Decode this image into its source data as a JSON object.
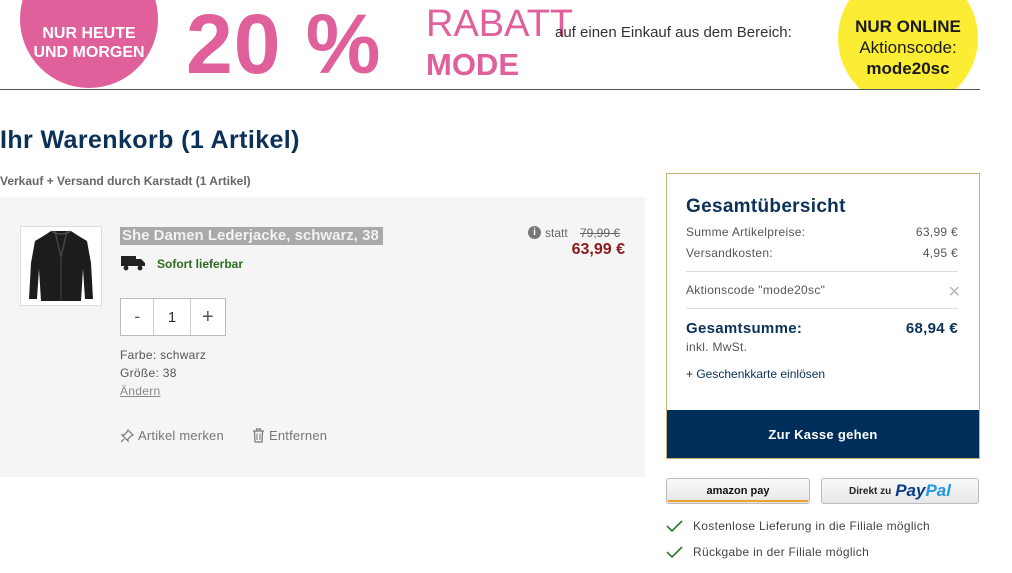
{
  "banner": {
    "left_circle_line1": "NUR HEUTE",
    "left_circle_line2": "UND MORGEN",
    "percent": "20 %",
    "rabatt": "RABATT",
    "mode": "MODE",
    "description": "auf einen Einkauf aus dem Bereich:",
    "online_line1": "NUR ONLINE",
    "online_line2": "Aktionscode:",
    "online_code": "mode20sc"
  },
  "cart": {
    "title": "Ihr Warenkorb (1 Artikel)",
    "seller": "Verkauf + Versand durch Karstadt (1 Artikel)"
  },
  "item": {
    "name": "She Damen Lederjacke, schwarz, 38",
    "availability": "Sofort lieferbar",
    "statt_label": "statt",
    "old_price": "79,99 €",
    "price": "63,99 €",
    "qty_minus": "-",
    "qty_value": "1",
    "qty_plus": "+",
    "color": "Farbe: schwarz",
    "size": "Größe: 38",
    "change": "Ändern",
    "remember": "Artikel merken",
    "remove": "Entfernen"
  },
  "summary": {
    "title": "Gesamtübersicht",
    "items_label": "Summe Artikelpreise:",
    "items_value": "63,99 €",
    "shipping_label": "Versandkosten:",
    "shipping_value": "4,95 €",
    "promo": "Aktionscode \"mode20sc\"",
    "total_label": "Gesamtsumme:",
    "total_value": "68,94 €",
    "vat": "inkl. MwSt.",
    "giftcard": "+ Geschenkkarte einlösen",
    "checkout": "Zur Kasse gehen"
  },
  "payment": {
    "amazon": "amazon pay",
    "paypal_prefix": "Direkt zu",
    "paypal_a": "Pay",
    "paypal_b": "Pal"
  },
  "benefits": [
    "Kostenlose Lieferung in die Filiale möglich",
    "Rückgabe in der Filiale möglich"
  ],
  "colors": {
    "navy": "#0b3158",
    "pink": "#e0609c",
    "yellow": "#fbec34",
    "price_red": "#8b1a1a",
    "green": "#2d6b1f"
  }
}
